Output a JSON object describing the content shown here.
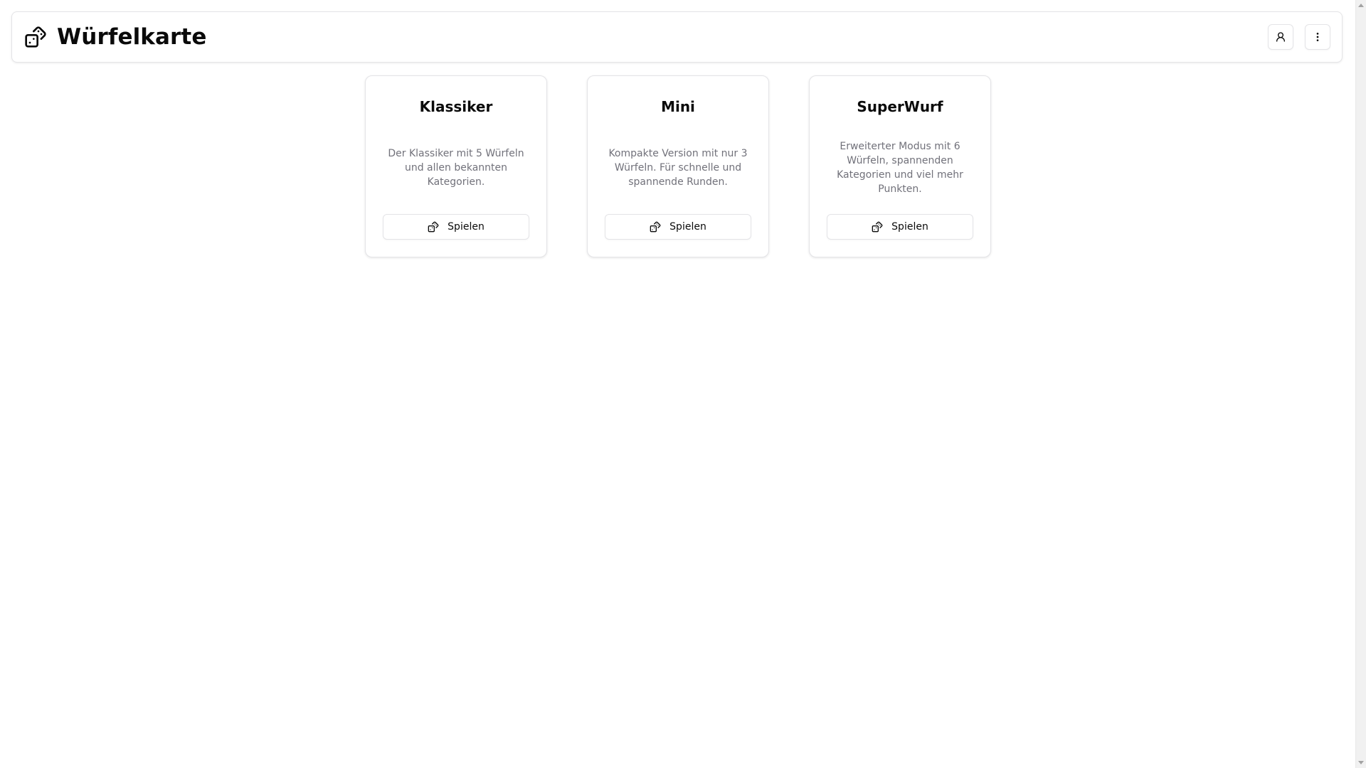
{
  "app": {
    "title": "Würfelkarte",
    "logo_icon": "dices-icon"
  },
  "header": {
    "actions": [
      {
        "icon": "user-icon"
      },
      {
        "icon": "more-vertical-icon"
      }
    ]
  },
  "cards": [
    {
      "title": "Klassiker",
      "description": "Der Klassiker mit 5 Würfeln und allen bekannten Kategorien.",
      "button_label": "Spielen",
      "button_icon": "dices-icon"
    },
    {
      "title": "Mini",
      "description": "Kompakte Version mit nur 3 Würfeln. Für schnelle und spannende Runden.",
      "button_label": "Spielen",
      "button_icon": "dices-icon"
    },
    {
      "title": "SuperWurf",
      "description": "Erweiterter Modus mit 6 Würfeln, spannenden Kategorien und viel mehr Punkten.",
      "button_label": "Spielen",
      "button_icon": "dices-icon"
    }
  ],
  "colors": {
    "text": "#0a0a0a",
    "muted_text": "#71717a",
    "border": "#e4e4e7",
    "background": "#ffffff"
  }
}
